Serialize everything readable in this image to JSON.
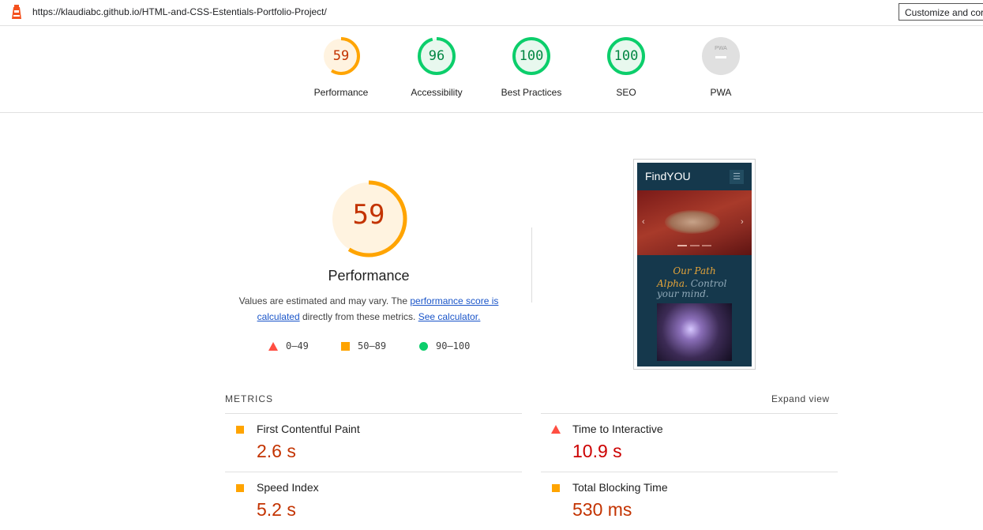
{
  "browser": {
    "url": "https://klaudiabc.github.io/HTML-and-CSS-Estentials-Portfolio-Project/",
    "customize_label": "Customize and cor"
  },
  "colors": {
    "fail": "#ff4e42",
    "average": "#ffa400",
    "pass": "#0cce6b",
    "average_text": "#c33300",
    "pass_text": "#018642",
    "fail_text": "#cc0000"
  },
  "categories": [
    {
      "label": "Performance",
      "score": "59",
      "rating": "average"
    },
    {
      "label": "Accessibility",
      "score": "96",
      "rating": "pass"
    },
    {
      "label": "Best Practices",
      "score": "100",
      "rating": "pass"
    },
    {
      "label": "SEO",
      "score": "100",
      "rating": "pass"
    },
    {
      "label": "PWA",
      "score": "–",
      "rating": "na",
      "icon_text": "PWA"
    }
  ],
  "performance": {
    "score": "59",
    "title": "Performance",
    "desc_prefix": "Values are estimated and may vary. The ",
    "desc_link1": "performance score is calculated",
    "desc_middle": " directly from these metrics. ",
    "desc_link2": "See calculator."
  },
  "legend": [
    {
      "range": "0–49",
      "icon": "triangle-icon"
    },
    {
      "range": "50–89",
      "icon": "square-icon"
    },
    {
      "range": "90–100",
      "icon": "circle-icon"
    }
  ],
  "screenshot": {
    "brand": "FindYOU",
    "heading": "Our Path",
    "highlight": "Alpha.",
    "tagline": " Control your mind."
  },
  "metrics": {
    "title": "METRICS",
    "expand_label": "Expand view",
    "items": [
      {
        "name": "First Contentful Paint",
        "value": "2.6 s",
        "rating": "average"
      },
      {
        "name": "Time to Interactive",
        "value": "10.9 s",
        "rating": "fail"
      },
      {
        "name": "Speed Index",
        "value": "5.2 s",
        "rating": "average"
      },
      {
        "name": "Total Blocking Time",
        "value": "530 ms",
        "rating": "average"
      }
    ]
  }
}
